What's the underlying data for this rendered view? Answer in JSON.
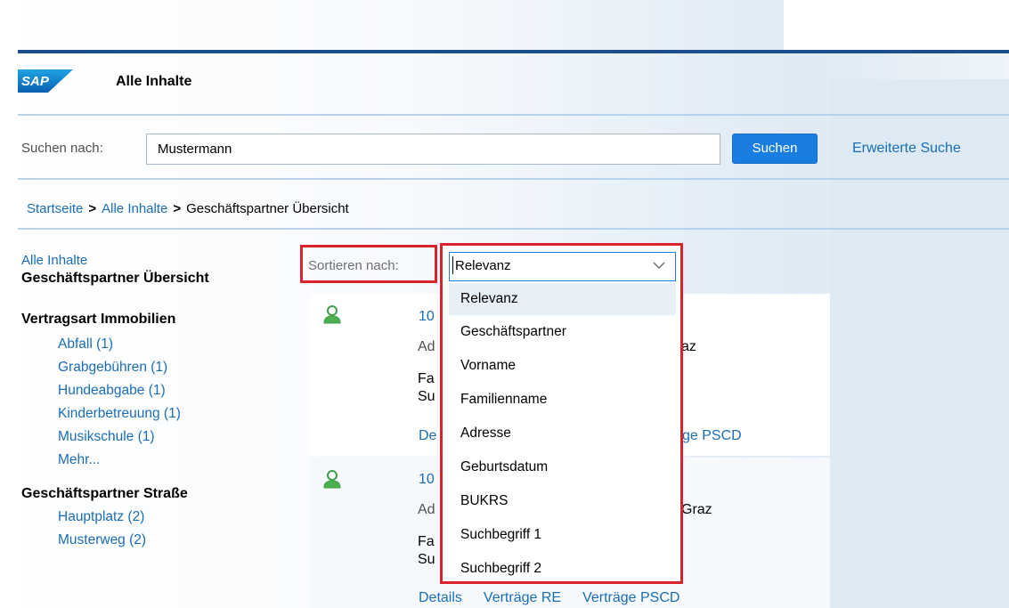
{
  "header": {
    "logo_text": "SAP",
    "title": "Alle Inhalte"
  },
  "search": {
    "label": "Suchen nach:",
    "value": "Mustermann",
    "button_label": "Suchen",
    "advanced_link": "Erweiterte Suche"
  },
  "breadcrumb": {
    "items": [
      "Startseite",
      "Alle Inhalte",
      "Geschäftspartner Übersicht"
    ],
    "separator": ">"
  },
  "sidebar": {
    "all_link": "Alle Inhalte",
    "current": "Geschäftspartner Übersicht",
    "groups": [
      {
        "title": "Vertragsart Immobilien",
        "items": [
          "Abfall (1)",
          "Grabgebühren (1)",
          "Hundeabgabe (1)",
          "Kinderbetreuung (1)",
          "Musikschule (1)",
          "Mehr..."
        ]
      },
      {
        "title": "Geschäftspartner Straße",
        "items": [
          "Hauptplatz (2)",
          "Musterweg (2)"
        ]
      }
    ]
  },
  "sort": {
    "label": "Sortieren nach:",
    "selected": "Relevanz",
    "options": [
      "Relevanz",
      "Geschäftspartner",
      "Vorname",
      "Familienname",
      "Adresse",
      "Geburtsdatum",
      "BUKRS",
      "Suchbegriff 1",
      "Suchbegriff 2"
    ]
  },
  "results": [
    {
      "id_fragment": "10",
      "address_prefix": "Ad",
      "address_suffix": "az",
      "line3_prefix": "Fa",
      "line4_prefix": "Su",
      "link_details": "De",
      "link_psc_suffix": "ge PSCD"
    },
    {
      "id_fragment": "10",
      "address_prefix": "Ad",
      "address_suffix": "Graz",
      "line3_prefix": "Fa",
      "line4_prefix": "Su",
      "link_details": "Details",
      "link_re": "Verträge RE",
      "link_pscd": "Verträge PSCD"
    }
  ],
  "colors": {
    "accent_blue": "#1a7de0",
    "link_blue": "#1a6db5",
    "highlight_red": "#d9232d",
    "top_bar": "#1a4f8c",
    "person_icon": "#4caf50"
  },
  "icons": {
    "person": "person-icon",
    "chevron": "chevron-down-icon"
  }
}
